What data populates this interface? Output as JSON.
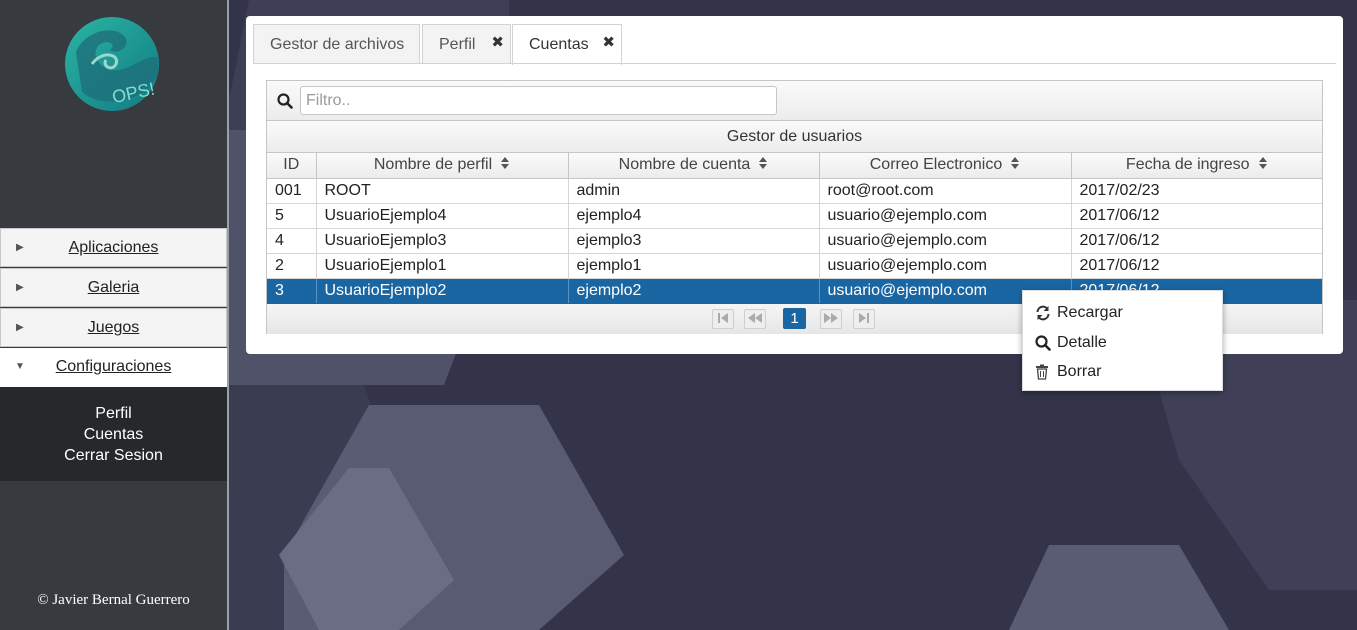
{
  "sidebar": {
    "logo_text": "OPS!",
    "items": [
      {
        "label": "Aplicaciones",
        "arrow": "▶"
      },
      {
        "label": "Galeria",
        "arrow": "▶"
      },
      {
        "label": "Juegos",
        "arrow": "▶"
      },
      {
        "label": "Configuraciones",
        "arrow": "▼"
      }
    ],
    "submenu": [
      "Perfil",
      "Cuentas",
      "Cerrar Sesion"
    ],
    "footer": "© Javier Bernal Guerrero"
  },
  "tabs": [
    {
      "label": "Gestor de archivos",
      "closable": false
    },
    {
      "label": "Perfil",
      "closable": true
    },
    {
      "label": "Cuentas",
      "closable": true,
      "active": true
    }
  ],
  "tab_close_glyph": "✖",
  "grid": {
    "filter_placeholder": "Filtro..",
    "caption": "Gestor de usuarios",
    "columns": [
      "ID",
      "Nombre de perfil",
      "Nombre de cuenta",
      "Correo Electronico",
      "Fecha de ingreso"
    ],
    "rows": [
      [
        "001",
        "ROOT",
        "admin",
        "root@root.com",
        "2017/02/23"
      ],
      [
        "5",
        "UsuarioEjemplo4",
        "ejemplo4",
        "usuario@ejemplo.com",
        "2017/06/12"
      ],
      [
        "4",
        "UsuarioEjemplo3",
        "ejemplo3",
        "usuario@ejemplo.com",
        "2017/06/12"
      ],
      [
        "2",
        "UsuarioEjemplo1",
        "ejemplo1",
        "usuario@ejemplo.com",
        "2017/06/12"
      ],
      [
        "3",
        "UsuarioEjemplo2",
        "ejemplo2",
        "usuario@ejemplo.com",
        "2017/06/12"
      ]
    ],
    "selected_row": 4,
    "current_page": "1"
  },
  "context_menu": [
    {
      "label": "Recargar",
      "icon": "refresh-icon"
    },
    {
      "label": "Detalle",
      "icon": "search-icon"
    },
    {
      "label": "Borrar",
      "icon": "trash-icon"
    }
  ],
  "colors": {
    "selection": "#1a66a3",
    "sidebar": "#373b40",
    "logo": "#1a9e8f"
  }
}
